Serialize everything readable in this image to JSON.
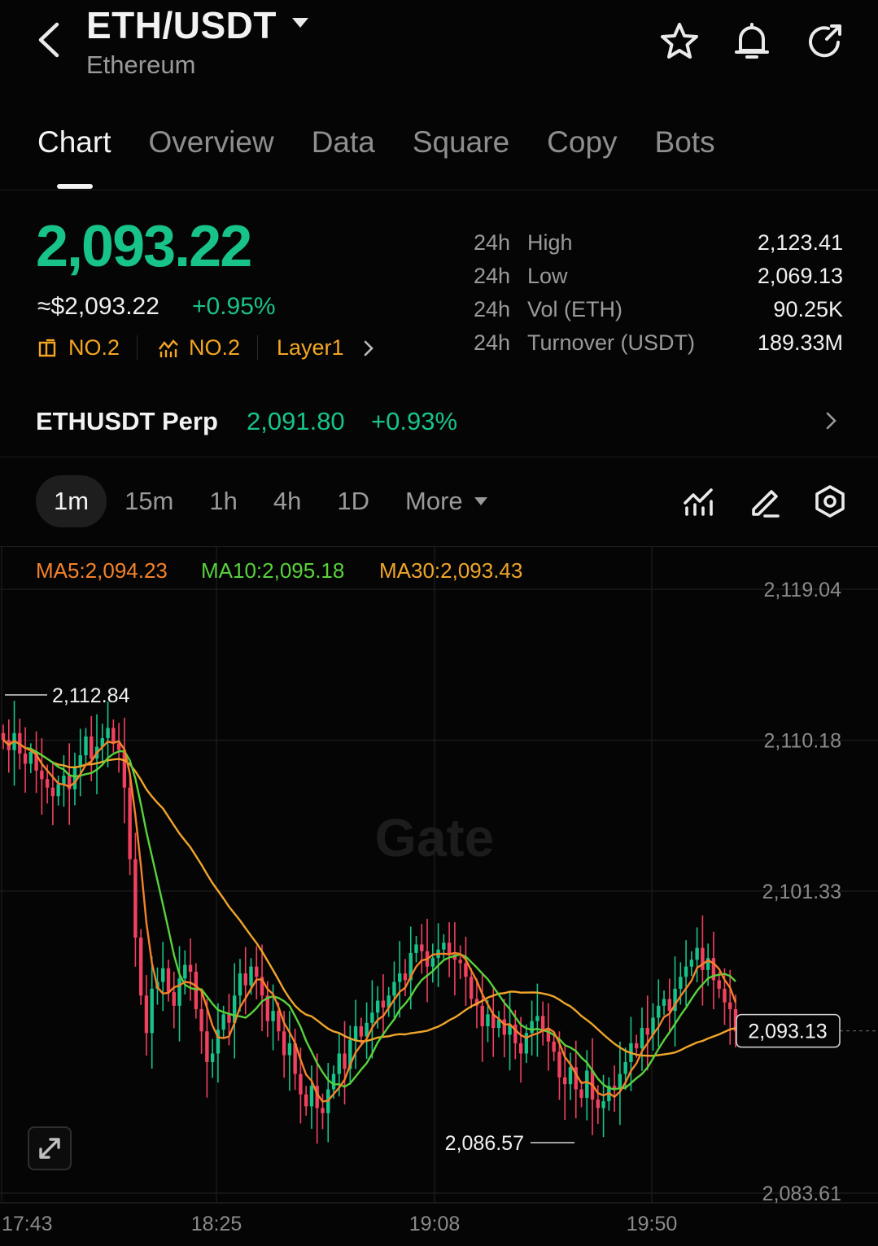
{
  "header": {
    "pair": "ETH/USDT",
    "name": "Ethereum",
    "icons": [
      "back-icon",
      "star-icon",
      "bell-icon",
      "share-icon"
    ]
  },
  "tabs": [
    {
      "label": "Chart",
      "active": true
    },
    {
      "label": "Overview",
      "active": false
    },
    {
      "label": "Data",
      "active": false
    },
    {
      "label": "Square",
      "active": false
    },
    {
      "label": "Copy",
      "active": false
    },
    {
      "label": "Bots",
      "active": false
    }
  ],
  "price": {
    "last": "2,093.22",
    "fiat": "≈$2,093.22",
    "change": "+0.95%",
    "rank1": "NO.2",
    "rank2": "NO.2",
    "sector": "Layer1"
  },
  "stats": [
    {
      "prefix": "24h",
      "label": "High",
      "value": "2,123.41"
    },
    {
      "prefix": "24h",
      "label": "Low",
      "value": "2,069.13"
    },
    {
      "prefix": "24h",
      "label": "Vol (ETH)",
      "value": "90.25K"
    },
    {
      "prefix": "24h",
      "label": "Turnover (USDT)",
      "value": "189.33M"
    }
  ],
  "perp": {
    "name": "ETHUSDT Perp",
    "price": "2,091.80",
    "change": "+0.93%"
  },
  "intervals": {
    "items": [
      "1m",
      "15m",
      "1h",
      "4h",
      "1D"
    ],
    "active": "1m",
    "more": "More"
  },
  "colors": {
    "up": "#18c38a",
    "down": "#f0415e",
    "ma5": "#f5822a",
    "ma10": "#58d23c",
    "ma30": "#f0a52a",
    "accent": "#f5a623"
  },
  "chart_data": {
    "type": "candlestick",
    "interval": "1m",
    "ma_legend": [
      {
        "label": "MA5:2,094.23"
      },
      {
        "label": "MA10:2,095.18"
      },
      {
        "label": "MA30:2,093.43"
      }
    ],
    "y_ticks": [
      "2,119.04",
      "2,110.18",
      "2,101.33",
      "2,083.61"
    ],
    "x_ticks": [
      "17:43",
      "18:25",
      "19:08",
      "19:50"
    ],
    "ylim": [
      2083.61,
      2119.04
    ],
    "high_label": "2,112.84",
    "low_label": "2,086.57",
    "last_label": "2,093.13",
    "watermark": "Gate",
    "close": [
      2110.2,
      2109.6,
      2110.6,
      2109.4,
      2108.8,
      2109.5,
      2108.4,
      2107.9,
      2107.4,
      2106.9,
      2107.6,
      2108.1,
      2107.3,
      2108.6,
      2109.3,
      2110.4,
      2109.1,
      2109.8,
      2110.3,
      2110.9,
      2110.0,
      2109.6,
      2107.4,
      2103.2,
      2098.6,
      2095.2,
      2093.0,
      2095.6,
      2096.0,
      2096.8,
      2095.4,
      2094.6,
      2096.2,
      2097.0,
      2096.6,
      2094.4,
      2093.1,
      2091.3,
      2091.8,
      2093.2,
      2094.1,
      2093.6,
      2095.2,
      2096.5,
      2095.8,
      2096.9,
      2096.3,
      2095.2,
      2093.7,
      2094.3,
      2093.1,
      2091.7,
      2092.4,
      2090.6,
      2089.4,
      2088.7,
      2089.9,
      2088.6,
      2088.3,
      2089.7,
      2090.6,
      2091.8,
      2090.9,
      2092.6,
      2093.4,
      2092.8,
      2093.6,
      2094.2,
      2094.9,
      2094.5,
      2095.2,
      2096.0,
      2096.5,
      2096.1,
      2097.7,
      2098.2,
      2097.8,
      2096.9,
      2097.4,
      2097.9,
      2098.3,
      2097.6,
      2097.3,
      2097.1,
      2096.3,
      2095.0,
      2094.6,
      2093.4,
      2094.1,
      2093.3,
      2093.8,
      2092.9,
      2093.5,
      2092.4,
      2091.8,
      2093.0,
      2093.7,
      2094.0,
      2093.2,
      2092.5,
      2091.9,
      2090.4,
      2090.0,
      2091.0,
      2089.7,
      2089.2,
      2090.8,
      2089.1,
      2088.6,
      2089.0,
      2089.9,
      2089.7,
      2090.6,
      2091.3,
      2092.4,
      2092.1,
      2093.3,
      2092.9,
      2093.9,
      2094.6,
      2095.0,
      2094.3,
      2095.6,
      2096.3,
      2096.9,
      2097.3,
      2098.0,
      2096.7,
      2097.4,
      2096.1,
      2095.6,
      2094.8,
      2094.4,
      2093.1
    ]
  }
}
